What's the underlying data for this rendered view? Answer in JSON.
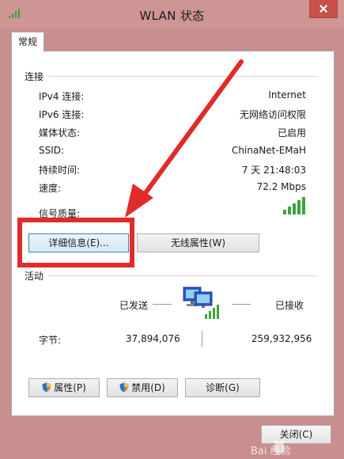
{
  "window": {
    "title": "WLAN 状态"
  },
  "tabs": [
    {
      "label": "常规"
    }
  ],
  "connection": {
    "section_label": "连接",
    "rows": [
      {
        "label": "IPv4 连接:",
        "value": "Internet"
      },
      {
        "label": "IPv6 连接:",
        "value": "无网络访问权限"
      },
      {
        "label": "媒体状态:",
        "value": "已启用"
      },
      {
        "label": "SSID:",
        "value": "ChinaNet-EMaH"
      },
      {
        "label": "持续时间:",
        "value": "7 天 21:48:03"
      },
      {
        "label": "速度:",
        "value": "72.2 Mbps"
      }
    ],
    "signal_label": "信号质量:",
    "signal_bars": 5,
    "details_button": "详细信息(E)...",
    "wireless_props_button": "无线属性(W)"
  },
  "activity": {
    "section_label": "活动",
    "sent_label": "已发送",
    "received_label": "已接收",
    "bytes_label": "字节:",
    "bytes_sent": "37,894,076",
    "bytes_received": "259,932,956"
  },
  "actions": {
    "properties": "属性(P)",
    "disable": "禁用(D)",
    "diagnose": "诊断(G)"
  },
  "footer": {
    "close": "关闭(C)"
  },
  "watermark": {
    "text": "Bai 经验"
  },
  "colors": {
    "annotation": "#e02b2b",
    "signal": "#3aa63a",
    "titlebar": "#cf9494"
  }
}
